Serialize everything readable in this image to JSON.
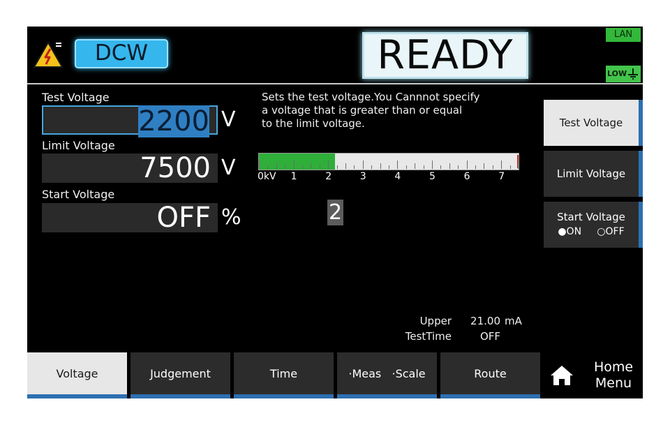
{
  "header": {
    "mode": "DCW",
    "status": "READY",
    "lan_label": "LAN",
    "low_label": "LOW"
  },
  "settings": {
    "test_voltage": {
      "label": "Test Voltage",
      "value": "2200",
      "unit": "V"
    },
    "limit_voltage": {
      "label": "Limit Voltage",
      "value": "7500",
      "unit": "V"
    },
    "start_voltage": {
      "label": "Start Voltage",
      "value": "OFF",
      "unit": "%"
    }
  },
  "help": {
    "line1": "Sets the test voltage.You Cannnot specify",
    "line2": "a voltage that is greater than or equal",
    "line3": "to the limit voltage."
  },
  "voltage_bar": {
    "scale_labels": [
      "0kV",
      "1",
      "2",
      "3",
      "4",
      "5",
      "6",
      "7"
    ],
    "scale_max_kv": 7.5,
    "fill_kv": 2.2,
    "limit_kv": 7.5
  },
  "cursor_digit": "2",
  "info": {
    "upper_label": "Upper",
    "upper_value": "21.00",
    "upper_unit": "mA",
    "testtime_label": "TestTime",
    "testtime_value": "OFF"
  },
  "side_keys": {
    "test_voltage": "Test Voltage",
    "limit_voltage": "Limit Voltage",
    "start_voltage": "Start Voltage",
    "on_label": "ON",
    "off_label": "OFF"
  },
  "tabs": {
    "voltage": "Voltage",
    "judgement": "Judgement",
    "time": "Time",
    "meas": "·Meas",
    "scale": "·Scale",
    "route": "Route"
  },
  "home": {
    "line1": "Home",
    "line2": "Menu"
  },
  "colors": {
    "accent_blue": "#2d6fb0",
    "badge_blue": "#35b6ec",
    "bar_green": "#2fae3a",
    "lan_green": "#33b83a"
  }
}
